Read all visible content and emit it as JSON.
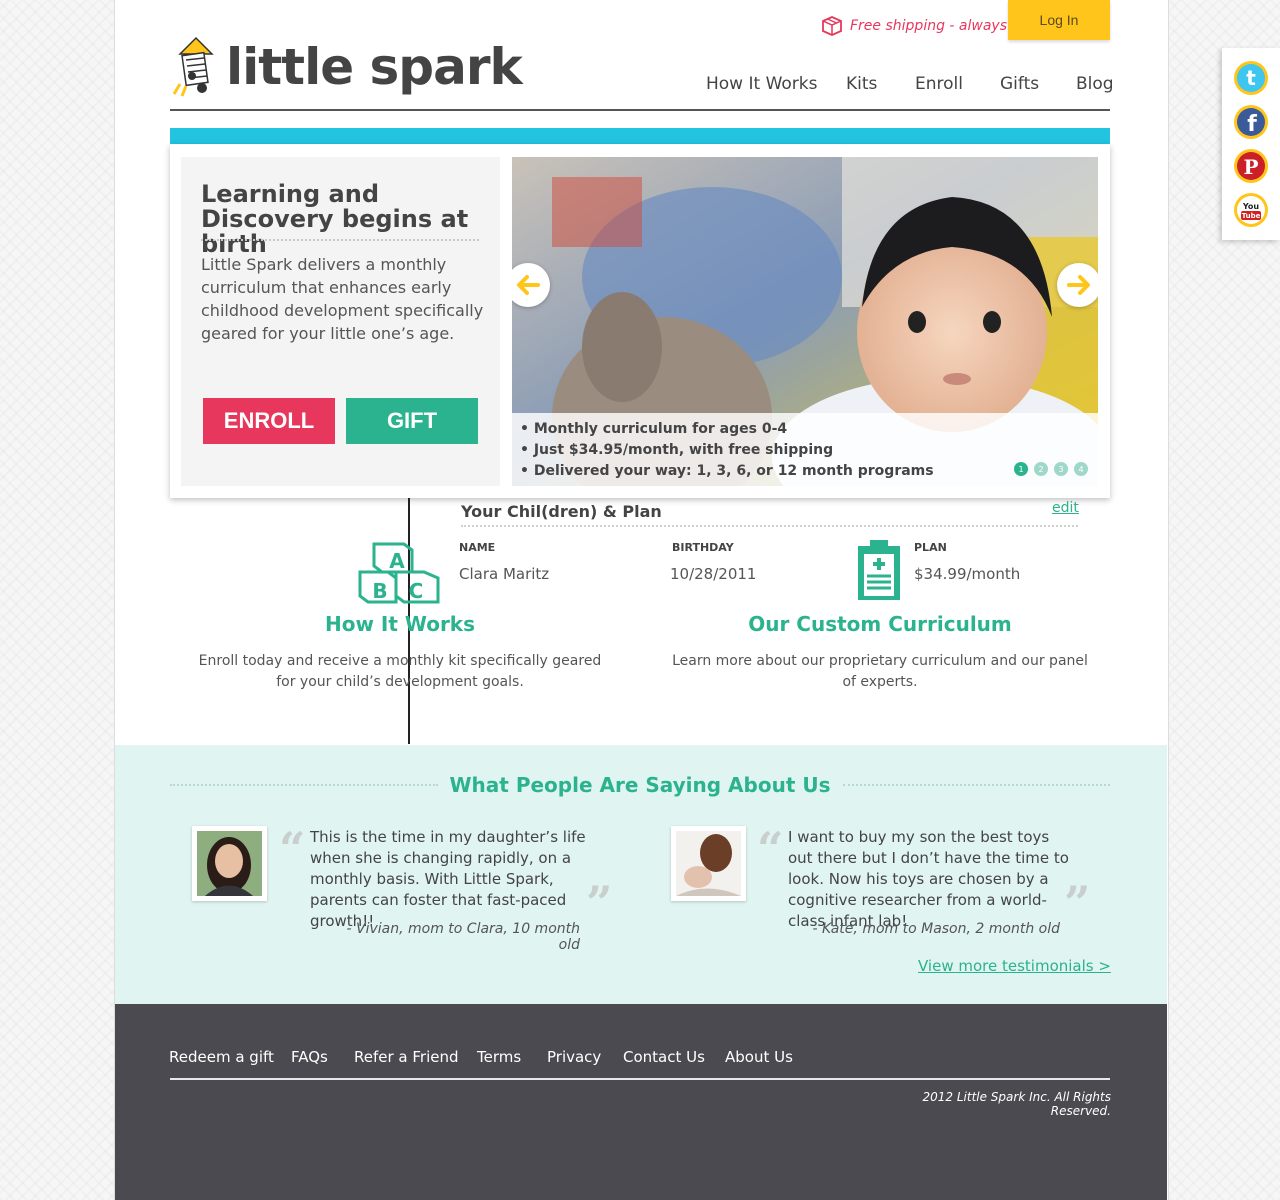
{
  "header": {
    "free_shipping": "Free shipping - always!",
    "login": "Log In",
    "logo_text": "little spark"
  },
  "nav": [
    "How It Works",
    "Kits",
    "Enroll",
    "Gifts",
    "Blog"
  ],
  "hero": {
    "title": "Learning and Discovery begins at birth",
    "description": "Little Spark delivers a monthly curriculum that enhances early childhood development specifically geared for your little one’s age.",
    "enroll": "ENROLL",
    "gift": "GIFT",
    "caption": [
      "• Monthly curriculum for ages 0-4",
      "• Just $34.95/month, with free shipping",
      "• Delivered your way: 1, 3, 6, or 12 month programs"
    ],
    "pages": [
      "1",
      "2",
      "3",
      "4"
    ],
    "active_page": "1"
  },
  "plan": {
    "title": "Your Chil(dren) & Plan",
    "edit": "edit",
    "headers": {
      "name": "NAME",
      "birthday": "BIRTHDAY",
      "plan": "PLAN"
    },
    "row": {
      "name": "Clara Maritz",
      "birthday": "10/28/2011",
      "plan": "$34.99/month"
    }
  },
  "features": [
    {
      "title": "How It Works",
      "desc": "Enroll today and receive a monthly kit specifically geared for your child’s development goals."
    },
    {
      "title": "Our Custom Curriculum",
      "desc": "Learn more about our proprietary curriculum and our panel of experts."
    }
  ],
  "testimonials": {
    "heading": "What People Are Saying About Us",
    "items": [
      {
        "text": "This is the time in my daughter’s life when she is changing rapidly, on a monthly basis. With Little Spark, parents can foster that fast-paced growth!!",
        "author": "- Vivian, mom to Clara, 10 month old"
      },
      {
        "text": "I want to buy my son the best toys out there but I don’t have the time to look. Now his toys are chosen by a cognitive researcher from a world-class infant lab!",
        "author": "- Kate, mom to Mason, 2 month old"
      }
    ],
    "view_more": "View more testimonials >"
  },
  "footer": {
    "links": [
      "Redeem a gift",
      "FAQs",
      "Refer a Friend",
      "Terms",
      "Privacy",
      "Contact Us",
      "About Us"
    ],
    "copyright": "2012 Little Spark Inc. All Rights Reserved."
  },
  "social": [
    {
      "icon": "twitter-icon",
      "glyph": "t",
      "color": "#3dc6ef"
    },
    {
      "icon": "facebook-icon",
      "glyph": "f",
      "color": "#3b5a9a"
    },
    {
      "icon": "pinterest-icon",
      "glyph": "P",
      "color": "#cb2027"
    },
    {
      "icon": "youtube-icon",
      "glyph": "You Tube",
      "color": "#d02222"
    }
  ],
  "colors": {
    "accent_teal": "#2bb28e",
    "accent_pink": "#e8375c",
    "accent_yellow": "#ffc51a",
    "hero_bar": "#22c4e0",
    "testimonial_bg": "#e0f4f1",
    "footer_bg": "#4a4a50"
  }
}
